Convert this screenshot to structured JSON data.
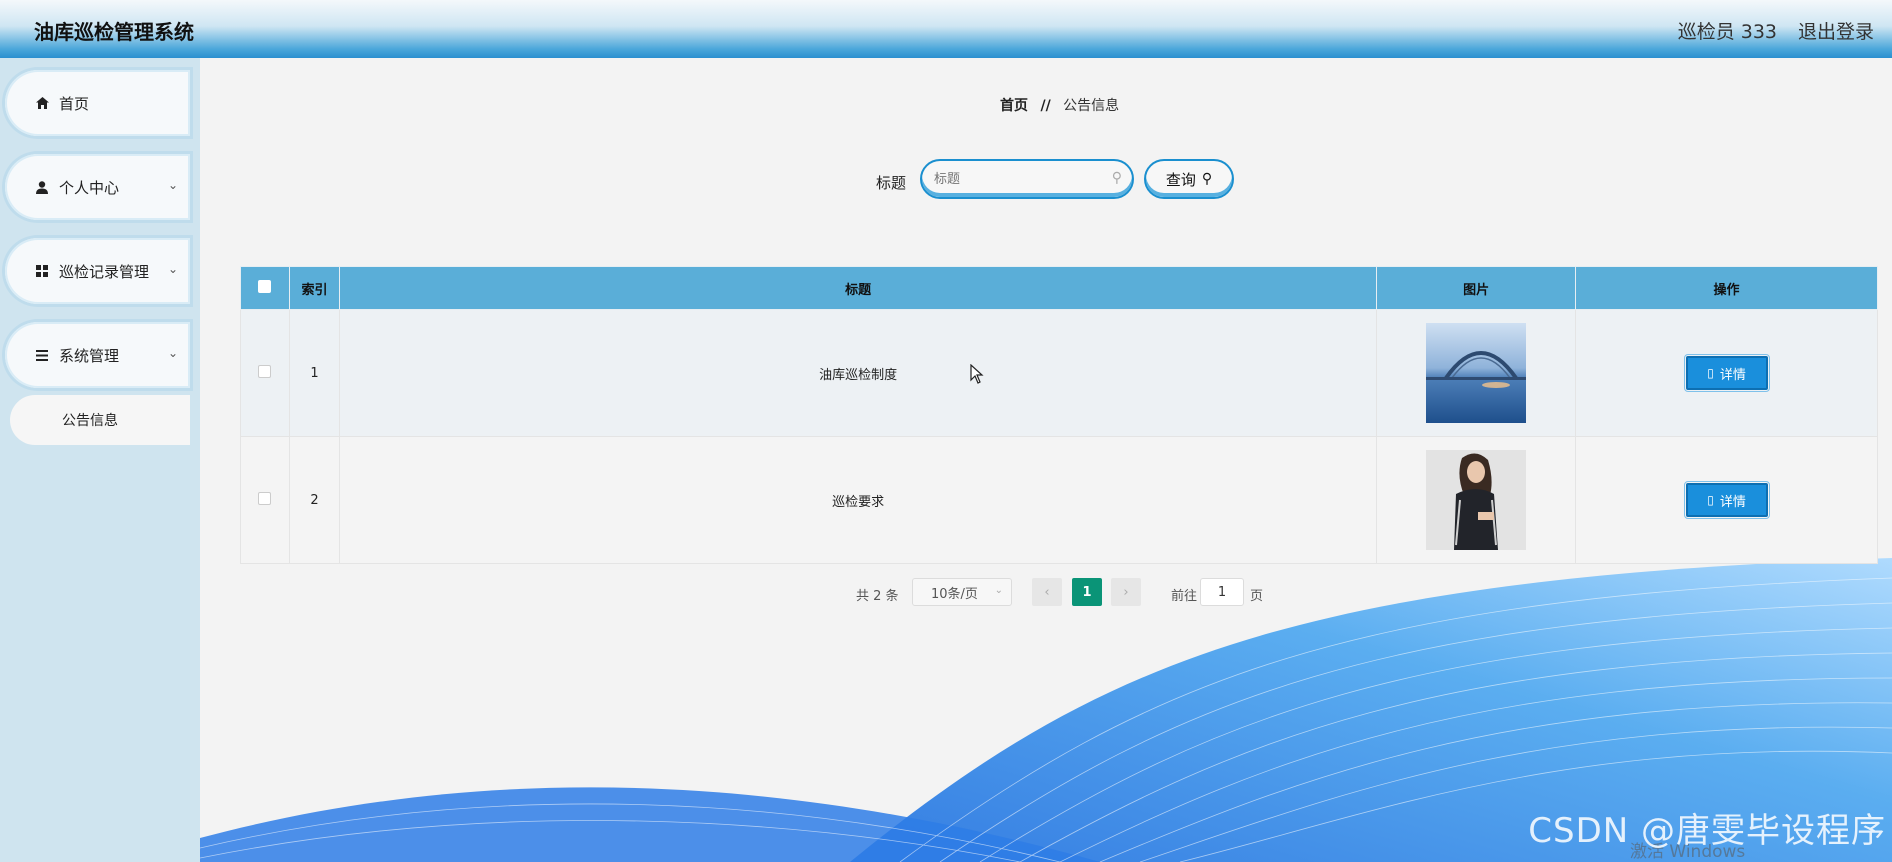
{
  "header": {
    "app_title": "油库巡检管理系统",
    "user": "巡检员 333",
    "logout": "退出登录"
  },
  "sidebar": {
    "items": [
      {
        "label": "首页",
        "icon": "home-icon"
      },
      {
        "label": "个人中心",
        "icon": "user-icon"
      },
      {
        "label": "巡检记录管理",
        "icon": "grid-icon"
      },
      {
        "label": "系统管理",
        "icon": "list-icon"
      }
    ],
    "sub_items": [
      {
        "label": "公告信息"
      }
    ]
  },
  "breadcrumb": {
    "home": "首页",
    "separator": "//",
    "current": "公告信息"
  },
  "search": {
    "label": "标题",
    "placeholder": "标题",
    "button": "查询"
  },
  "table": {
    "columns": [
      "索引",
      "标题",
      "图片",
      "操作"
    ],
    "rows": [
      {
        "index": "1",
        "title": "油库巡检制度",
        "image": "bridge-photo",
        "action": "详情"
      },
      {
        "index": "2",
        "title": "巡检要求",
        "image": "woman-photo",
        "action": "详情"
      }
    ]
  },
  "pagination": {
    "total": "共 2 条",
    "page_size": "10条/页",
    "current_page": "1",
    "goto_label": "前往",
    "goto_value": "1",
    "goto_suffix": "页"
  },
  "watermark": "CSDN @唐雯毕设程序",
  "activation_hint": "激活 Windows",
  "colors": {
    "accent": "#1a8fdc",
    "table_header": "#5aaed8",
    "page_active": "#0a9477",
    "sidebar_bg": "#cfe4ef"
  }
}
